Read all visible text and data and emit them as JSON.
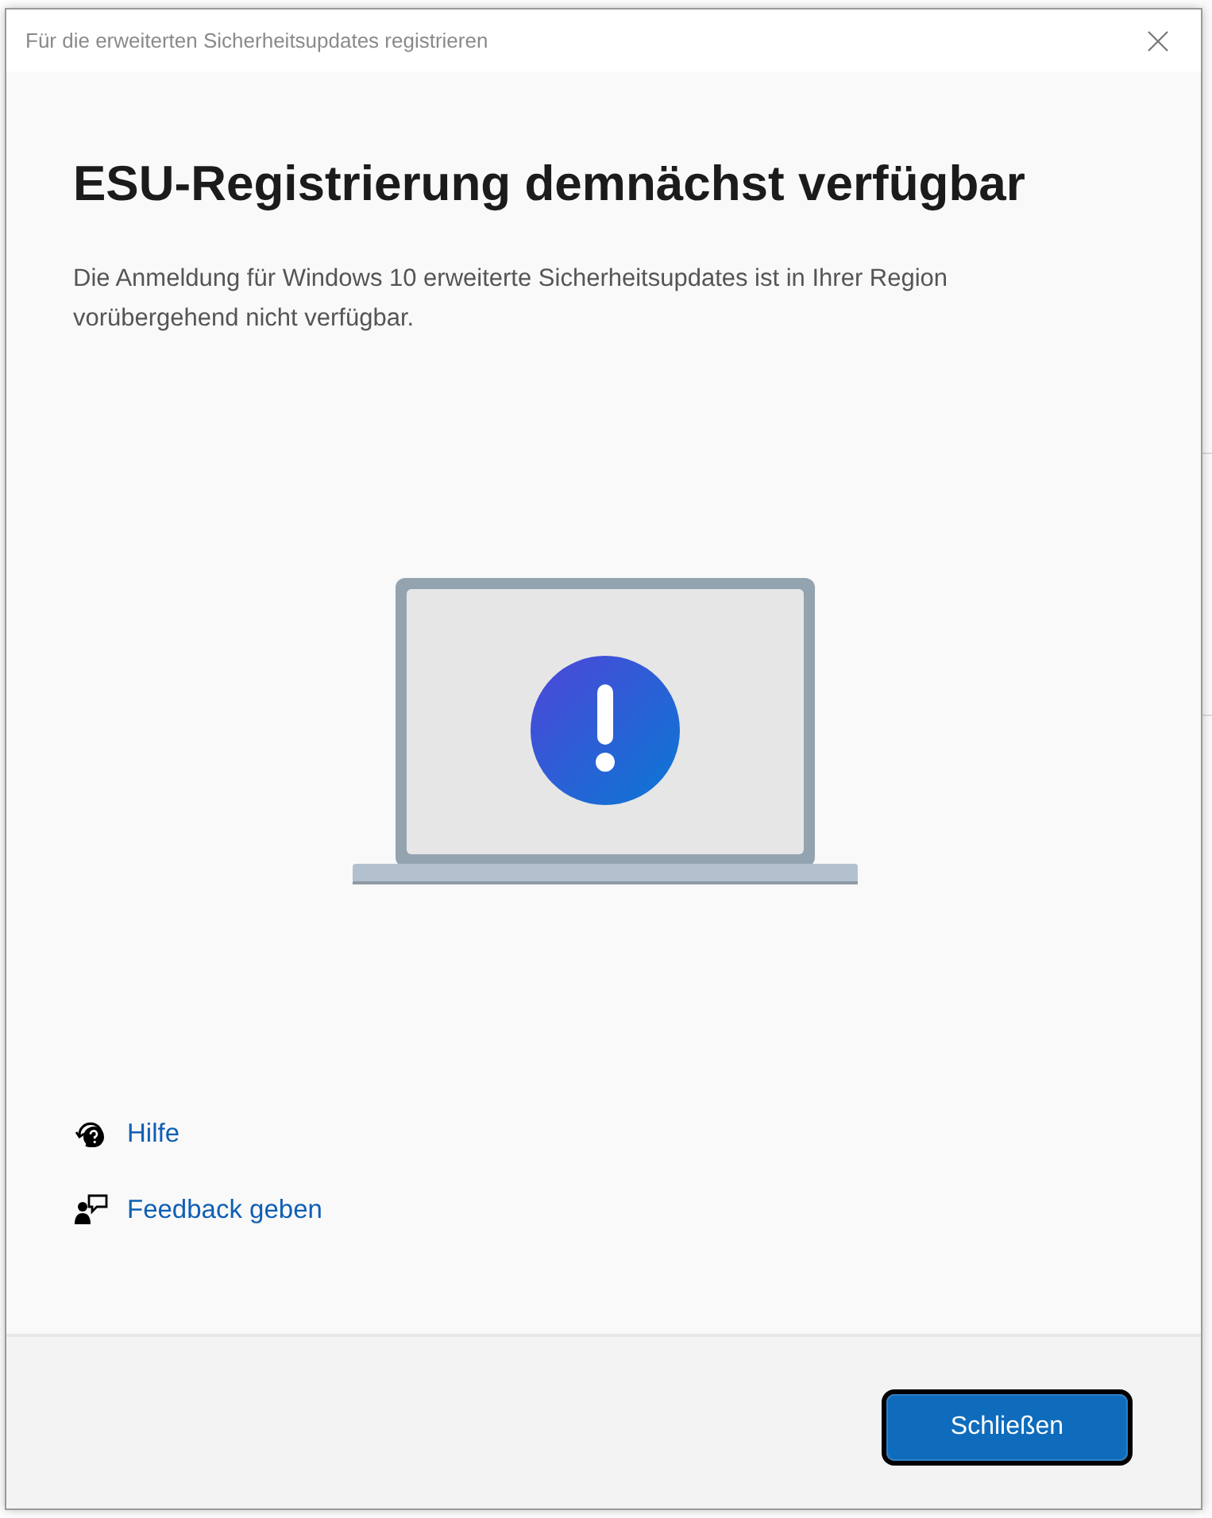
{
  "window": {
    "title": "Für die erweiterten Sicherheitsupdates registrieren"
  },
  "heading": "ESU-Registrierung demnächst verfügbar",
  "description": "Die Anmeldung für Windows 10 erweiterte Sicherheitsupdates ist in Ihrer Region vorübergehend nicht verfügbar.",
  "links": [
    {
      "kind": "help",
      "label": "Hilfe"
    },
    {
      "kind": "feedback",
      "label": "Feedback geben"
    }
  ],
  "buttons": [
    {
      "label": "Schließen",
      "focused": true
    }
  ]
}
